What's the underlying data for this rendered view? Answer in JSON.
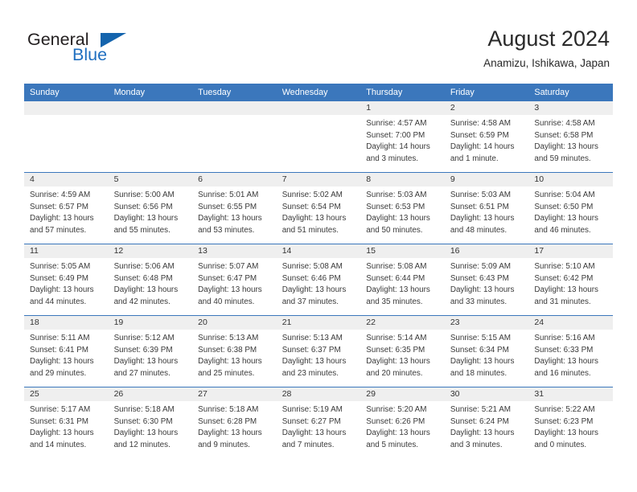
{
  "brand": {
    "name_part1": "General",
    "name_part2": "Blue",
    "accent_color": "#1464ad"
  },
  "header": {
    "title": "August 2024",
    "subtitle": "Anamizu, Ishikawa, Japan"
  },
  "calendar": {
    "header_bg": "#3b77bc",
    "daynum_bg": "#efefef",
    "weekday_headers": [
      "Sunday",
      "Monday",
      "Tuesday",
      "Wednesday",
      "Thursday",
      "Friday",
      "Saturday"
    ],
    "weeks": [
      [
        {
          "day": "",
          "sunrise": "",
          "sunset": "",
          "daylight_line1": "",
          "daylight_line2": ""
        },
        {
          "day": "",
          "sunrise": "",
          "sunset": "",
          "daylight_line1": "",
          "daylight_line2": ""
        },
        {
          "day": "",
          "sunrise": "",
          "sunset": "",
          "daylight_line1": "",
          "daylight_line2": ""
        },
        {
          "day": "",
          "sunrise": "",
          "sunset": "",
          "daylight_line1": "",
          "daylight_line2": ""
        },
        {
          "day": "1",
          "sunrise": "Sunrise: 4:57 AM",
          "sunset": "Sunset: 7:00 PM",
          "daylight_line1": "Daylight: 14 hours",
          "daylight_line2": "and 3 minutes."
        },
        {
          "day": "2",
          "sunrise": "Sunrise: 4:58 AM",
          "sunset": "Sunset: 6:59 PM",
          "daylight_line1": "Daylight: 14 hours",
          "daylight_line2": "and 1 minute."
        },
        {
          "day": "3",
          "sunrise": "Sunrise: 4:58 AM",
          "sunset": "Sunset: 6:58 PM",
          "daylight_line1": "Daylight: 13 hours",
          "daylight_line2": "and 59 minutes."
        }
      ],
      [
        {
          "day": "4",
          "sunrise": "Sunrise: 4:59 AM",
          "sunset": "Sunset: 6:57 PM",
          "daylight_line1": "Daylight: 13 hours",
          "daylight_line2": "and 57 minutes."
        },
        {
          "day": "5",
          "sunrise": "Sunrise: 5:00 AM",
          "sunset": "Sunset: 6:56 PM",
          "daylight_line1": "Daylight: 13 hours",
          "daylight_line2": "and 55 minutes."
        },
        {
          "day": "6",
          "sunrise": "Sunrise: 5:01 AM",
          "sunset": "Sunset: 6:55 PM",
          "daylight_line1": "Daylight: 13 hours",
          "daylight_line2": "and 53 minutes."
        },
        {
          "day": "7",
          "sunrise": "Sunrise: 5:02 AM",
          "sunset": "Sunset: 6:54 PM",
          "daylight_line1": "Daylight: 13 hours",
          "daylight_line2": "and 51 minutes."
        },
        {
          "day": "8",
          "sunrise": "Sunrise: 5:03 AM",
          "sunset": "Sunset: 6:53 PM",
          "daylight_line1": "Daylight: 13 hours",
          "daylight_line2": "and 50 minutes."
        },
        {
          "day": "9",
          "sunrise": "Sunrise: 5:03 AM",
          "sunset": "Sunset: 6:51 PM",
          "daylight_line1": "Daylight: 13 hours",
          "daylight_line2": "and 48 minutes."
        },
        {
          "day": "10",
          "sunrise": "Sunrise: 5:04 AM",
          "sunset": "Sunset: 6:50 PM",
          "daylight_line1": "Daylight: 13 hours",
          "daylight_line2": "and 46 minutes."
        }
      ],
      [
        {
          "day": "11",
          "sunrise": "Sunrise: 5:05 AM",
          "sunset": "Sunset: 6:49 PM",
          "daylight_line1": "Daylight: 13 hours",
          "daylight_line2": "and 44 minutes."
        },
        {
          "day": "12",
          "sunrise": "Sunrise: 5:06 AM",
          "sunset": "Sunset: 6:48 PM",
          "daylight_line1": "Daylight: 13 hours",
          "daylight_line2": "and 42 minutes."
        },
        {
          "day": "13",
          "sunrise": "Sunrise: 5:07 AM",
          "sunset": "Sunset: 6:47 PM",
          "daylight_line1": "Daylight: 13 hours",
          "daylight_line2": "and 40 minutes."
        },
        {
          "day": "14",
          "sunrise": "Sunrise: 5:08 AM",
          "sunset": "Sunset: 6:46 PM",
          "daylight_line1": "Daylight: 13 hours",
          "daylight_line2": "and 37 minutes."
        },
        {
          "day": "15",
          "sunrise": "Sunrise: 5:08 AM",
          "sunset": "Sunset: 6:44 PM",
          "daylight_line1": "Daylight: 13 hours",
          "daylight_line2": "and 35 minutes."
        },
        {
          "day": "16",
          "sunrise": "Sunrise: 5:09 AM",
          "sunset": "Sunset: 6:43 PM",
          "daylight_line1": "Daylight: 13 hours",
          "daylight_line2": "and 33 minutes."
        },
        {
          "day": "17",
          "sunrise": "Sunrise: 5:10 AM",
          "sunset": "Sunset: 6:42 PM",
          "daylight_line1": "Daylight: 13 hours",
          "daylight_line2": "and 31 minutes."
        }
      ],
      [
        {
          "day": "18",
          "sunrise": "Sunrise: 5:11 AM",
          "sunset": "Sunset: 6:41 PM",
          "daylight_line1": "Daylight: 13 hours",
          "daylight_line2": "and 29 minutes."
        },
        {
          "day": "19",
          "sunrise": "Sunrise: 5:12 AM",
          "sunset": "Sunset: 6:39 PM",
          "daylight_line1": "Daylight: 13 hours",
          "daylight_line2": "and 27 minutes."
        },
        {
          "day": "20",
          "sunrise": "Sunrise: 5:13 AM",
          "sunset": "Sunset: 6:38 PM",
          "daylight_line1": "Daylight: 13 hours",
          "daylight_line2": "and 25 minutes."
        },
        {
          "day": "21",
          "sunrise": "Sunrise: 5:13 AM",
          "sunset": "Sunset: 6:37 PM",
          "daylight_line1": "Daylight: 13 hours",
          "daylight_line2": "and 23 minutes."
        },
        {
          "day": "22",
          "sunrise": "Sunrise: 5:14 AM",
          "sunset": "Sunset: 6:35 PM",
          "daylight_line1": "Daylight: 13 hours",
          "daylight_line2": "and 20 minutes."
        },
        {
          "day": "23",
          "sunrise": "Sunrise: 5:15 AM",
          "sunset": "Sunset: 6:34 PM",
          "daylight_line1": "Daylight: 13 hours",
          "daylight_line2": "and 18 minutes."
        },
        {
          "day": "24",
          "sunrise": "Sunrise: 5:16 AM",
          "sunset": "Sunset: 6:33 PM",
          "daylight_line1": "Daylight: 13 hours",
          "daylight_line2": "and 16 minutes."
        }
      ],
      [
        {
          "day": "25",
          "sunrise": "Sunrise: 5:17 AM",
          "sunset": "Sunset: 6:31 PM",
          "daylight_line1": "Daylight: 13 hours",
          "daylight_line2": "and 14 minutes."
        },
        {
          "day": "26",
          "sunrise": "Sunrise: 5:18 AM",
          "sunset": "Sunset: 6:30 PM",
          "daylight_line1": "Daylight: 13 hours",
          "daylight_line2": "and 12 minutes."
        },
        {
          "day": "27",
          "sunrise": "Sunrise: 5:18 AM",
          "sunset": "Sunset: 6:28 PM",
          "daylight_line1": "Daylight: 13 hours",
          "daylight_line2": "and 9 minutes."
        },
        {
          "day": "28",
          "sunrise": "Sunrise: 5:19 AM",
          "sunset": "Sunset: 6:27 PM",
          "daylight_line1": "Daylight: 13 hours",
          "daylight_line2": "and 7 minutes."
        },
        {
          "day": "29",
          "sunrise": "Sunrise: 5:20 AM",
          "sunset": "Sunset: 6:26 PM",
          "daylight_line1": "Daylight: 13 hours",
          "daylight_line2": "and 5 minutes."
        },
        {
          "day": "30",
          "sunrise": "Sunrise: 5:21 AM",
          "sunset": "Sunset: 6:24 PM",
          "daylight_line1": "Daylight: 13 hours",
          "daylight_line2": "and 3 minutes."
        },
        {
          "day": "31",
          "sunrise": "Sunrise: 5:22 AM",
          "sunset": "Sunset: 6:23 PM",
          "daylight_line1": "Daylight: 13 hours",
          "daylight_line2": "and 0 minutes."
        }
      ]
    ]
  }
}
